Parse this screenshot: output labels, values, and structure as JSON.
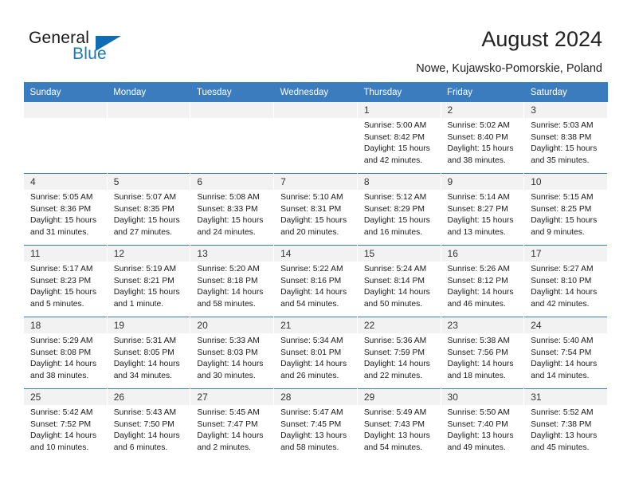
{
  "brand": {
    "name_part1": "General",
    "name_part2": "Blue",
    "accent_color": "#1878be",
    "triangle_color": "#0d6db5"
  },
  "header": {
    "title": "August 2024",
    "location": "Nowe, Kujawsko-Pomorskie, Poland"
  },
  "calendar": {
    "header_bg": "#3a7cbe",
    "daynum_bg": "#f2f2f2",
    "weekday_headers": [
      "Sunday",
      "Monday",
      "Tuesday",
      "Wednesday",
      "Thursday",
      "Friday",
      "Saturday"
    ],
    "weeks": [
      [
        {
          "day": "",
          "sunrise": "",
          "sunset": "",
          "daylight_line1": "",
          "daylight_line2": "",
          "empty": true
        },
        {
          "day": "",
          "sunrise": "",
          "sunset": "",
          "daylight_line1": "",
          "daylight_line2": "",
          "empty": true
        },
        {
          "day": "",
          "sunrise": "",
          "sunset": "",
          "daylight_line1": "",
          "daylight_line2": "",
          "empty": true
        },
        {
          "day": "",
          "sunrise": "",
          "sunset": "",
          "daylight_line1": "",
          "daylight_line2": "",
          "empty": true
        },
        {
          "day": "1",
          "sunrise": "Sunrise: 5:00 AM",
          "sunset": "Sunset: 8:42 PM",
          "daylight_line1": "Daylight: 15 hours",
          "daylight_line2": "and 42 minutes."
        },
        {
          "day": "2",
          "sunrise": "Sunrise: 5:02 AM",
          "sunset": "Sunset: 8:40 PM",
          "daylight_line1": "Daylight: 15 hours",
          "daylight_line2": "and 38 minutes."
        },
        {
          "day": "3",
          "sunrise": "Sunrise: 5:03 AM",
          "sunset": "Sunset: 8:38 PM",
          "daylight_line1": "Daylight: 15 hours",
          "daylight_line2": "and 35 minutes."
        }
      ],
      [
        {
          "day": "4",
          "sunrise": "Sunrise: 5:05 AM",
          "sunset": "Sunset: 8:36 PM",
          "daylight_line1": "Daylight: 15 hours",
          "daylight_line2": "and 31 minutes."
        },
        {
          "day": "5",
          "sunrise": "Sunrise: 5:07 AM",
          "sunset": "Sunset: 8:35 PM",
          "daylight_line1": "Daylight: 15 hours",
          "daylight_line2": "and 27 minutes."
        },
        {
          "day": "6",
          "sunrise": "Sunrise: 5:08 AM",
          "sunset": "Sunset: 8:33 PM",
          "daylight_line1": "Daylight: 15 hours",
          "daylight_line2": "and 24 minutes."
        },
        {
          "day": "7",
          "sunrise": "Sunrise: 5:10 AM",
          "sunset": "Sunset: 8:31 PM",
          "daylight_line1": "Daylight: 15 hours",
          "daylight_line2": "and 20 minutes."
        },
        {
          "day": "8",
          "sunrise": "Sunrise: 5:12 AM",
          "sunset": "Sunset: 8:29 PM",
          "daylight_line1": "Daylight: 15 hours",
          "daylight_line2": "and 16 minutes."
        },
        {
          "day": "9",
          "sunrise": "Sunrise: 5:14 AM",
          "sunset": "Sunset: 8:27 PM",
          "daylight_line1": "Daylight: 15 hours",
          "daylight_line2": "and 13 minutes."
        },
        {
          "day": "10",
          "sunrise": "Sunrise: 5:15 AM",
          "sunset": "Sunset: 8:25 PM",
          "daylight_line1": "Daylight: 15 hours",
          "daylight_line2": "and 9 minutes."
        }
      ],
      [
        {
          "day": "11",
          "sunrise": "Sunrise: 5:17 AM",
          "sunset": "Sunset: 8:23 PM",
          "daylight_line1": "Daylight: 15 hours",
          "daylight_line2": "and 5 minutes."
        },
        {
          "day": "12",
          "sunrise": "Sunrise: 5:19 AM",
          "sunset": "Sunset: 8:21 PM",
          "daylight_line1": "Daylight: 15 hours",
          "daylight_line2": "and 1 minute."
        },
        {
          "day": "13",
          "sunrise": "Sunrise: 5:20 AM",
          "sunset": "Sunset: 8:18 PM",
          "daylight_line1": "Daylight: 14 hours",
          "daylight_line2": "and 58 minutes."
        },
        {
          "day": "14",
          "sunrise": "Sunrise: 5:22 AM",
          "sunset": "Sunset: 8:16 PM",
          "daylight_line1": "Daylight: 14 hours",
          "daylight_line2": "and 54 minutes."
        },
        {
          "day": "15",
          "sunrise": "Sunrise: 5:24 AM",
          "sunset": "Sunset: 8:14 PM",
          "daylight_line1": "Daylight: 14 hours",
          "daylight_line2": "and 50 minutes."
        },
        {
          "day": "16",
          "sunrise": "Sunrise: 5:26 AM",
          "sunset": "Sunset: 8:12 PM",
          "daylight_line1": "Daylight: 14 hours",
          "daylight_line2": "and 46 minutes."
        },
        {
          "day": "17",
          "sunrise": "Sunrise: 5:27 AM",
          "sunset": "Sunset: 8:10 PM",
          "daylight_line1": "Daylight: 14 hours",
          "daylight_line2": "and 42 minutes."
        }
      ],
      [
        {
          "day": "18",
          "sunrise": "Sunrise: 5:29 AM",
          "sunset": "Sunset: 8:08 PM",
          "daylight_line1": "Daylight: 14 hours",
          "daylight_line2": "and 38 minutes."
        },
        {
          "day": "19",
          "sunrise": "Sunrise: 5:31 AM",
          "sunset": "Sunset: 8:05 PM",
          "daylight_line1": "Daylight: 14 hours",
          "daylight_line2": "and 34 minutes."
        },
        {
          "day": "20",
          "sunrise": "Sunrise: 5:33 AM",
          "sunset": "Sunset: 8:03 PM",
          "daylight_line1": "Daylight: 14 hours",
          "daylight_line2": "and 30 minutes."
        },
        {
          "day": "21",
          "sunrise": "Sunrise: 5:34 AM",
          "sunset": "Sunset: 8:01 PM",
          "daylight_line1": "Daylight: 14 hours",
          "daylight_line2": "and 26 minutes."
        },
        {
          "day": "22",
          "sunrise": "Sunrise: 5:36 AM",
          "sunset": "Sunset: 7:59 PM",
          "daylight_line1": "Daylight: 14 hours",
          "daylight_line2": "and 22 minutes."
        },
        {
          "day": "23",
          "sunrise": "Sunrise: 5:38 AM",
          "sunset": "Sunset: 7:56 PM",
          "daylight_line1": "Daylight: 14 hours",
          "daylight_line2": "and 18 minutes."
        },
        {
          "day": "24",
          "sunrise": "Sunrise: 5:40 AM",
          "sunset": "Sunset: 7:54 PM",
          "daylight_line1": "Daylight: 14 hours",
          "daylight_line2": "and 14 minutes."
        }
      ],
      [
        {
          "day": "25",
          "sunrise": "Sunrise: 5:42 AM",
          "sunset": "Sunset: 7:52 PM",
          "daylight_line1": "Daylight: 14 hours",
          "daylight_line2": "and 10 minutes."
        },
        {
          "day": "26",
          "sunrise": "Sunrise: 5:43 AM",
          "sunset": "Sunset: 7:50 PM",
          "daylight_line1": "Daylight: 14 hours",
          "daylight_line2": "and 6 minutes."
        },
        {
          "day": "27",
          "sunrise": "Sunrise: 5:45 AM",
          "sunset": "Sunset: 7:47 PM",
          "daylight_line1": "Daylight: 14 hours",
          "daylight_line2": "and 2 minutes."
        },
        {
          "day": "28",
          "sunrise": "Sunrise: 5:47 AM",
          "sunset": "Sunset: 7:45 PM",
          "daylight_line1": "Daylight: 13 hours",
          "daylight_line2": "and 58 minutes."
        },
        {
          "day": "29",
          "sunrise": "Sunrise: 5:49 AM",
          "sunset": "Sunset: 7:43 PM",
          "daylight_line1": "Daylight: 13 hours",
          "daylight_line2": "and 54 minutes."
        },
        {
          "day": "30",
          "sunrise": "Sunrise: 5:50 AM",
          "sunset": "Sunset: 7:40 PM",
          "daylight_line1": "Daylight: 13 hours",
          "daylight_line2": "and 49 minutes."
        },
        {
          "day": "31",
          "sunrise": "Sunrise: 5:52 AM",
          "sunset": "Sunset: 7:38 PM",
          "daylight_line1": "Daylight: 13 hours",
          "daylight_line2": "and 45 minutes."
        }
      ]
    ]
  }
}
